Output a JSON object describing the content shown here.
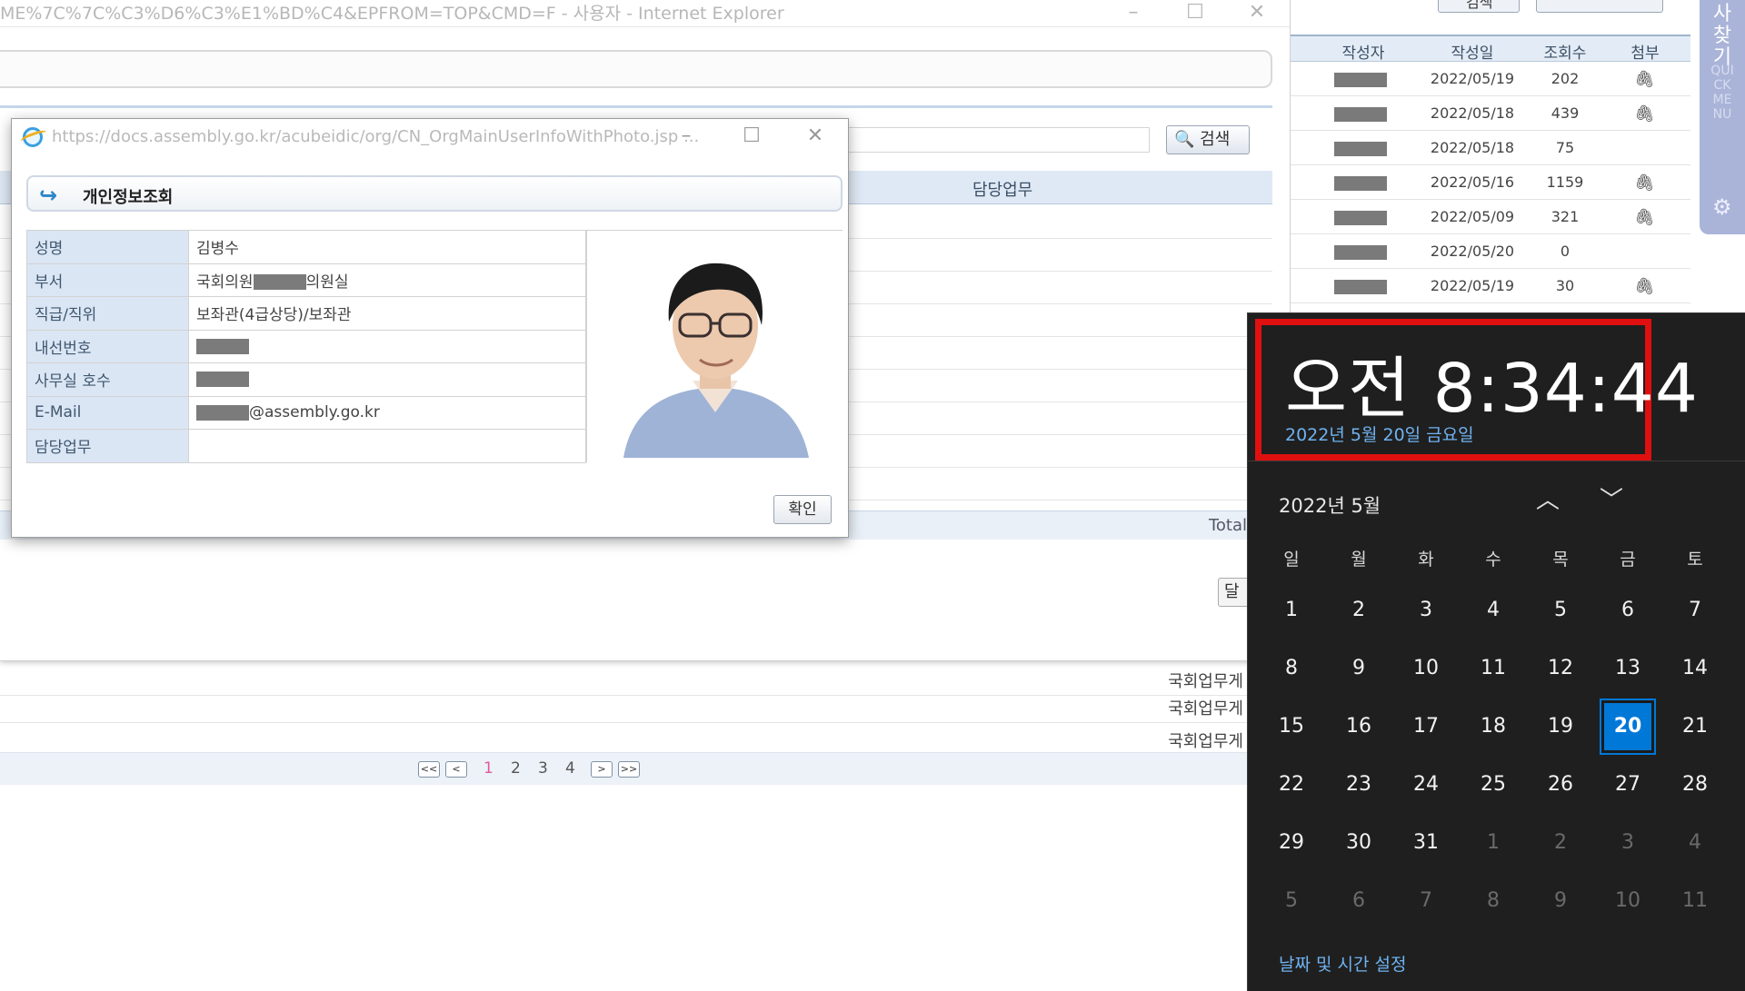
{
  "back_window": {
    "title": "ME%7C%7C%C3%D6%C3%E1%BD%C4&EPFROM=TOP&CMD=F - 사용자 - Internet Explorer",
    "search_button": "검색",
    "column_header": "담당업무",
    "total_label": "Total",
    "edge_button": "달"
  },
  "right_list": {
    "headers": [
      "작성자",
      "작성일",
      "조회수",
      "첨부"
    ],
    "top_search": "검색",
    "rows": [
      {
        "date": "2022/05/19",
        "views": "202",
        "attach": "🖇"
      },
      {
        "date": "2022/05/18",
        "views": "439",
        "attach": "🖇"
      },
      {
        "date": "2022/05/18",
        "views": "75",
        "attach": ""
      },
      {
        "date": "2022/05/16",
        "views": "1159",
        "attach": "🖇"
      },
      {
        "date": "2022/05/09",
        "views": "321",
        "attach": "🖇"
      },
      {
        "date": "2022/05/20",
        "views": "0",
        "attach": ""
      },
      {
        "date": "2022/05/19",
        "views": "30",
        "attach": "🖇"
      }
    ]
  },
  "quickmenu": {
    "label": "사찾기",
    "sub": "QUICKMENU",
    "icon": "gear-icon"
  },
  "bottom_list": {
    "rows": [
      "국회업무게",
      "국회업무게",
      "국회업무게"
    ],
    "pager": {
      "first": "<<",
      "prev": "<",
      "pages": [
        "1",
        "2",
        "3",
        "4"
      ],
      "next": ">",
      "last": ">>"
    }
  },
  "popup": {
    "url": "https://docs.assembly.go.kr/acubeidic/org/CN_OrgMainUserInfoWithPhoto.jsp ...",
    "title": "개인정보조회",
    "fields": [
      {
        "label": "성명",
        "value": "김병수"
      },
      {
        "label": "부서",
        "value_prefix": "국회의원",
        "value_suffix": "의원실"
      },
      {
        "label": "직급/직위",
        "value": "보좌관(4급상당)/보좌관"
      },
      {
        "label": "내선번호",
        "value": ""
      },
      {
        "label": "사무실 호수",
        "value": ""
      },
      {
        "label": "E-Mail",
        "value_suffix": "@assembly.go.kr"
      },
      {
        "label": "담당업무",
        "value": ""
      }
    ],
    "ok_button": "확인"
  },
  "clock": {
    "time": "오전 8:34:44",
    "date": "2022년 5월 20일 금요일",
    "month": "2022년 5월",
    "weekdays": [
      "일",
      "월",
      "화",
      "수",
      "목",
      "금",
      "토"
    ],
    "weeks": [
      [
        "1",
        "2",
        "3",
        "4",
        "5",
        "6",
        "7"
      ],
      [
        "8",
        "9",
        "10",
        "11",
        "12",
        "13",
        "14"
      ],
      [
        "15",
        "16",
        "17",
        "18",
        "19",
        "20",
        "21"
      ],
      [
        "22",
        "23",
        "24",
        "25",
        "26",
        "27",
        "28"
      ],
      [
        "29",
        "30",
        "31",
        "1",
        "2",
        "3",
        "4"
      ],
      [
        "5",
        "6",
        "7",
        "8",
        "9",
        "10",
        "11"
      ]
    ],
    "today": "20",
    "settings_link": "날짜 및 시간 설정",
    "highlight_color": "#e01010",
    "accent_color": "#0078d7"
  }
}
